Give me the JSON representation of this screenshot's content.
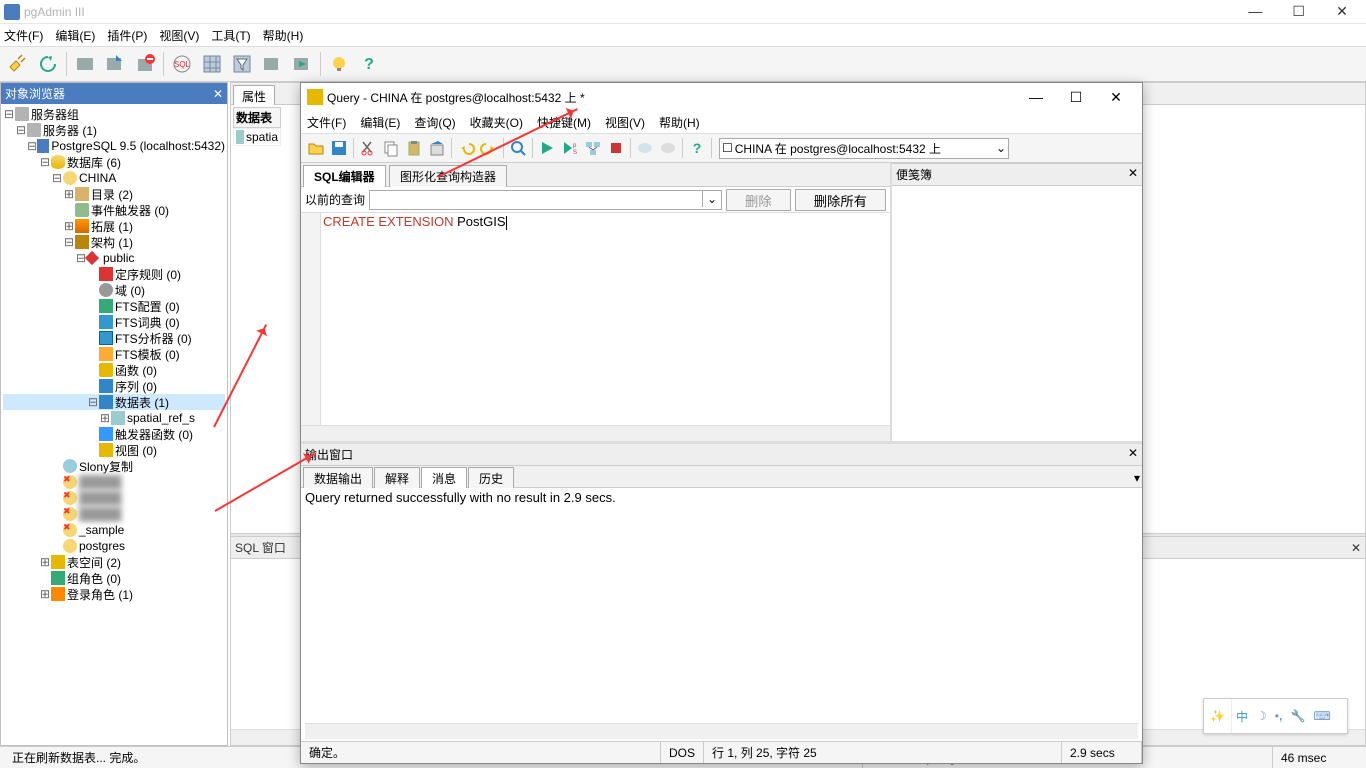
{
  "app": {
    "title": "pgAdmin III"
  },
  "winbtns": {
    "min": "—",
    "max": "☐",
    "close": "✕"
  },
  "menu": {
    "file": "文件(F)",
    "edit": "编辑(E)",
    "plugins": "插件(P)",
    "view": "视图(V)",
    "tools": "工具(T)",
    "help": "帮助(H)"
  },
  "sidebar": {
    "title": "对象浏览器",
    "root": "服务器组",
    "servers": "服务器 (1)",
    "pg": "PostgreSQL 9.5 (localhost:5432)",
    "databases": "数据库 (6)",
    "db_china": "CHINA",
    "catalogs": "目录 (2)",
    "evt_triggers": "事件触发器 (0)",
    "extensions": "拓展 (1)",
    "schemas": "架构 (1)",
    "public": "public",
    "collations": "定序规则 (0)",
    "domains": "域 (0)",
    "fts_cfg": "FTS配置 (0)",
    "fts_dict": "FTS词典 (0)",
    "fts_parser": "FTS分析器 (0)",
    "fts_tmpl": "FTS模板 (0)",
    "functions": "函数 (0)",
    "sequences": "序列 (0)",
    "tables": "数据表 (1)",
    "spatial_ref": "spatial_ref_s",
    "trig_fn": "触发器函数 (0)",
    "views": "视图 (0)",
    "slony": "Slony复制",
    "db_sample": "            _sample",
    "db_postgres": "postgres",
    "tablespaces": "表空间 (2)",
    "group_roles": "组角色 (0)",
    "login_roles": "登录角色 (1)"
  },
  "props": {
    "tab": "属性",
    "col_tables": "数据表",
    "cell": "spatia"
  },
  "sqlpane": {
    "title": "SQL 窗口"
  },
  "status": {
    "refresh": "正在刷新数据表... 完成。",
    "conn": "CHINA 在  postgres@localhost:5432 上",
    "time": "46 msec"
  },
  "query": {
    "title": "Query - CHINA 在  postgres@localhost:5432 上 *",
    "menu": {
      "file": "文件(F)",
      "edit": "编辑(E)",
      "query": "查询(Q)",
      "fav": "收藏夹(O)",
      "macro": "快捷键(M)",
      "view": "视图(V)",
      "help": "帮助(H)"
    },
    "conn": "CHINA 在  postgres@localhost:5432 上",
    "tabs": {
      "editor": "SQL编辑器",
      "graphic": "图形化查询构造器"
    },
    "prev_label": "以前的查询",
    "delete": "删除",
    "delete_all": "删除所有",
    "sql": {
      "kw": "CREATE EXTENSION ",
      "rest": "PostGIS"
    },
    "scratch": {
      "title": "便笺簿"
    },
    "output": {
      "title": "输出窗口",
      "tabs": {
        "data": "数据输出",
        "explain": "解释",
        "message": "消息",
        "history": "历史"
      },
      "msg": "Query returned successfully with no result in 2.9 secs."
    },
    "status": {
      "ok": "确定。",
      "enc": "DOS",
      "pos": "行 1, 列 25, 字符 25",
      "time": "2.9 secs"
    }
  },
  "ime": {
    "letter": "中"
  }
}
